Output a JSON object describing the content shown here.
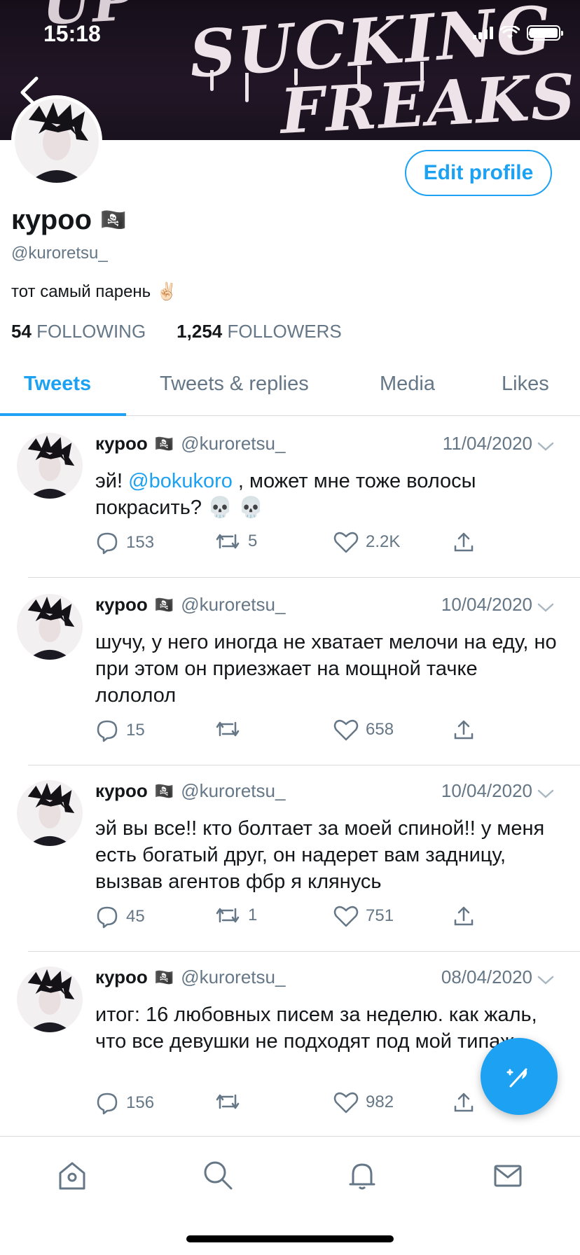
{
  "status_bar": {
    "time": "15:18"
  },
  "banner": {
    "line0": "UP",
    "line1": "SUCKING",
    "line2": "FREAKS"
  },
  "profile": {
    "display_name": "куроо",
    "name_emoji": "🏴‍☠️",
    "handle": "@kuroretsu_",
    "bio": "тот самый парень",
    "bio_emoji": "✌🏻",
    "following_count": "54",
    "following_label": "FOLLOWING",
    "followers_count": "1,254",
    "followers_label": "FOLLOWERS",
    "edit_label": "Edit profile"
  },
  "tabs": [
    {
      "label": "Tweets"
    },
    {
      "label": "Tweets & replies"
    },
    {
      "label": "Media"
    },
    {
      "label": "Likes"
    }
  ],
  "tweets": [
    {
      "name": "куроо",
      "flag": "🏴‍☠️",
      "handle": "@kuroretsu_",
      "date": "11/04/2020",
      "text_before": "эй! ",
      "mention": "@bokukoro",
      "text_after": " , может мне тоже волосы покрасить? 💀 💀",
      "replies": "153",
      "retweets": "5",
      "likes": "2.2K"
    },
    {
      "name": "куроо",
      "flag": "🏴‍☠️",
      "handle": "@kuroretsu_",
      "date": "10/04/2020",
      "text": "шучу, у него иногда не хватает мелочи на еду, но при этом он приезжает на мощной тачке лололол",
      "replies": "15",
      "retweets": "",
      "likes": "658"
    },
    {
      "name": "куроо",
      "flag": "🏴‍☠️",
      "handle": "@kuroretsu_",
      "date": "10/04/2020",
      "text": "эй вы все!! кто болтает за моей спиной!! у меня есть богатый друг, он надерет вам задницу, вызвав агентов фбр я клянусь",
      "replies": "45",
      "retweets": "1",
      "likes": "751"
    },
    {
      "name": "куроо",
      "flag": "🏴‍☠️",
      "handle": "@kuroretsu_",
      "date": "08/04/2020",
      "text": "итог: 16 любовных писем за неделю. как жаль, что все девушки не подходят под мой типаж~",
      "replies": "156",
      "retweets": "",
      "likes": "982"
    }
  ],
  "colors": {
    "accent": "#1da1f2",
    "muted": "#657786",
    "divider": "#d6dadd"
  }
}
